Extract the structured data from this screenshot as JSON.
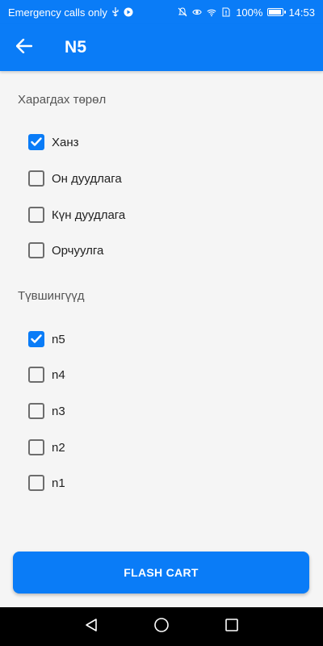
{
  "status_bar": {
    "carrier_text": "Emergency calls only",
    "battery": "100%",
    "battery_level": 1.0,
    "time": "14:53"
  },
  "app_bar": {
    "title": "N5"
  },
  "sections": {
    "types": {
      "title": "Харагдах төрөл",
      "items": [
        {
          "label": "Ханз",
          "checked": true
        },
        {
          "label": "Он дуудлага",
          "checked": false
        },
        {
          "label": "Күн дуудлага",
          "checked": false
        },
        {
          "label": "Орчуулга",
          "checked": false
        }
      ]
    },
    "levels": {
      "title": "Түвшингүүд",
      "items": [
        {
          "label": "n5",
          "checked": true
        },
        {
          "label": "n4",
          "checked": false
        },
        {
          "label": "n3",
          "checked": false
        },
        {
          "label": "n2",
          "checked": false
        },
        {
          "label": "n1",
          "checked": false
        }
      ]
    }
  },
  "cta": {
    "label": "FLASH CART"
  },
  "colors": {
    "primary": "#0a7cf7",
    "checkbox_border": "#6d6d6d"
  },
  "icons": {
    "back": "arrow-left-icon",
    "nav_back": "triangle-back-icon",
    "nav_home": "circle-home-icon",
    "nav_recents": "square-recents-icon"
  }
}
